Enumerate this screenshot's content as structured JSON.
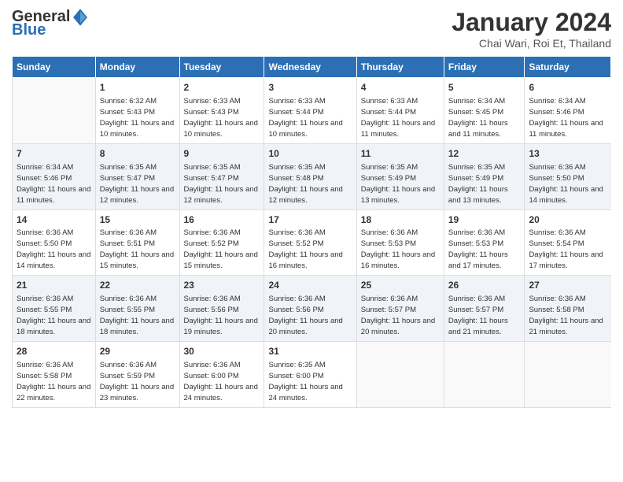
{
  "logo": {
    "general": "General",
    "blue": "Blue"
  },
  "title": "January 2024",
  "subtitle": "Chai Wari, Roi Et, Thailand",
  "days": [
    "Sunday",
    "Monday",
    "Tuesday",
    "Wednesday",
    "Thursday",
    "Friday",
    "Saturday"
  ],
  "weeks": [
    [
      {
        "num": "",
        "sunrise": "",
        "sunset": "",
        "daylight": ""
      },
      {
        "num": "1",
        "sunrise": "Sunrise: 6:32 AM",
        "sunset": "Sunset: 5:43 PM",
        "daylight": "Daylight: 11 hours and 10 minutes."
      },
      {
        "num": "2",
        "sunrise": "Sunrise: 6:33 AM",
        "sunset": "Sunset: 5:43 PM",
        "daylight": "Daylight: 11 hours and 10 minutes."
      },
      {
        "num": "3",
        "sunrise": "Sunrise: 6:33 AM",
        "sunset": "Sunset: 5:44 PM",
        "daylight": "Daylight: 11 hours and 10 minutes."
      },
      {
        "num": "4",
        "sunrise": "Sunrise: 6:33 AM",
        "sunset": "Sunset: 5:44 PM",
        "daylight": "Daylight: 11 hours and 11 minutes."
      },
      {
        "num": "5",
        "sunrise": "Sunrise: 6:34 AM",
        "sunset": "Sunset: 5:45 PM",
        "daylight": "Daylight: 11 hours and 11 minutes."
      },
      {
        "num": "6",
        "sunrise": "Sunrise: 6:34 AM",
        "sunset": "Sunset: 5:46 PM",
        "daylight": "Daylight: 11 hours and 11 minutes."
      }
    ],
    [
      {
        "num": "7",
        "sunrise": "Sunrise: 6:34 AM",
        "sunset": "Sunset: 5:46 PM",
        "daylight": "Daylight: 11 hours and 11 minutes."
      },
      {
        "num": "8",
        "sunrise": "Sunrise: 6:35 AM",
        "sunset": "Sunset: 5:47 PM",
        "daylight": "Daylight: 11 hours and 12 minutes."
      },
      {
        "num": "9",
        "sunrise": "Sunrise: 6:35 AM",
        "sunset": "Sunset: 5:47 PM",
        "daylight": "Daylight: 11 hours and 12 minutes."
      },
      {
        "num": "10",
        "sunrise": "Sunrise: 6:35 AM",
        "sunset": "Sunset: 5:48 PM",
        "daylight": "Daylight: 11 hours and 12 minutes."
      },
      {
        "num": "11",
        "sunrise": "Sunrise: 6:35 AM",
        "sunset": "Sunset: 5:49 PM",
        "daylight": "Daylight: 11 hours and 13 minutes."
      },
      {
        "num": "12",
        "sunrise": "Sunrise: 6:35 AM",
        "sunset": "Sunset: 5:49 PM",
        "daylight": "Daylight: 11 hours and 13 minutes."
      },
      {
        "num": "13",
        "sunrise": "Sunrise: 6:36 AM",
        "sunset": "Sunset: 5:50 PM",
        "daylight": "Daylight: 11 hours and 14 minutes."
      }
    ],
    [
      {
        "num": "14",
        "sunrise": "Sunrise: 6:36 AM",
        "sunset": "Sunset: 5:50 PM",
        "daylight": "Daylight: 11 hours and 14 minutes."
      },
      {
        "num": "15",
        "sunrise": "Sunrise: 6:36 AM",
        "sunset": "Sunset: 5:51 PM",
        "daylight": "Daylight: 11 hours and 15 minutes."
      },
      {
        "num": "16",
        "sunrise": "Sunrise: 6:36 AM",
        "sunset": "Sunset: 5:52 PM",
        "daylight": "Daylight: 11 hours and 15 minutes."
      },
      {
        "num": "17",
        "sunrise": "Sunrise: 6:36 AM",
        "sunset": "Sunset: 5:52 PM",
        "daylight": "Daylight: 11 hours and 16 minutes."
      },
      {
        "num": "18",
        "sunrise": "Sunrise: 6:36 AM",
        "sunset": "Sunset: 5:53 PM",
        "daylight": "Daylight: 11 hours and 16 minutes."
      },
      {
        "num": "19",
        "sunrise": "Sunrise: 6:36 AM",
        "sunset": "Sunset: 5:53 PM",
        "daylight": "Daylight: 11 hours and 17 minutes."
      },
      {
        "num": "20",
        "sunrise": "Sunrise: 6:36 AM",
        "sunset": "Sunset: 5:54 PM",
        "daylight": "Daylight: 11 hours and 17 minutes."
      }
    ],
    [
      {
        "num": "21",
        "sunrise": "Sunrise: 6:36 AM",
        "sunset": "Sunset: 5:55 PM",
        "daylight": "Daylight: 11 hours and 18 minutes."
      },
      {
        "num": "22",
        "sunrise": "Sunrise: 6:36 AM",
        "sunset": "Sunset: 5:55 PM",
        "daylight": "Daylight: 11 hours and 18 minutes."
      },
      {
        "num": "23",
        "sunrise": "Sunrise: 6:36 AM",
        "sunset": "Sunset: 5:56 PM",
        "daylight": "Daylight: 11 hours and 19 minutes."
      },
      {
        "num": "24",
        "sunrise": "Sunrise: 6:36 AM",
        "sunset": "Sunset: 5:56 PM",
        "daylight": "Daylight: 11 hours and 20 minutes."
      },
      {
        "num": "25",
        "sunrise": "Sunrise: 6:36 AM",
        "sunset": "Sunset: 5:57 PM",
        "daylight": "Daylight: 11 hours and 20 minutes."
      },
      {
        "num": "26",
        "sunrise": "Sunrise: 6:36 AM",
        "sunset": "Sunset: 5:57 PM",
        "daylight": "Daylight: 11 hours and 21 minutes."
      },
      {
        "num": "27",
        "sunrise": "Sunrise: 6:36 AM",
        "sunset": "Sunset: 5:58 PM",
        "daylight": "Daylight: 11 hours and 21 minutes."
      }
    ],
    [
      {
        "num": "28",
        "sunrise": "Sunrise: 6:36 AM",
        "sunset": "Sunset: 5:58 PM",
        "daylight": "Daylight: 11 hours and 22 minutes."
      },
      {
        "num": "29",
        "sunrise": "Sunrise: 6:36 AM",
        "sunset": "Sunset: 5:59 PM",
        "daylight": "Daylight: 11 hours and 23 minutes."
      },
      {
        "num": "30",
        "sunrise": "Sunrise: 6:36 AM",
        "sunset": "Sunset: 6:00 PM",
        "daylight": "Daylight: 11 hours and 24 minutes."
      },
      {
        "num": "31",
        "sunrise": "Sunrise: 6:35 AM",
        "sunset": "Sunset: 6:00 PM",
        "daylight": "Daylight: 11 hours and 24 minutes."
      },
      {
        "num": "",
        "sunrise": "",
        "sunset": "",
        "daylight": ""
      },
      {
        "num": "",
        "sunrise": "",
        "sunset": "",
        "daylight": ""
      },
      {
        "num": "",
        "sunrise": "",
        "sunset": "",
        "daylight": ""
      }
    ]
  ]
}
